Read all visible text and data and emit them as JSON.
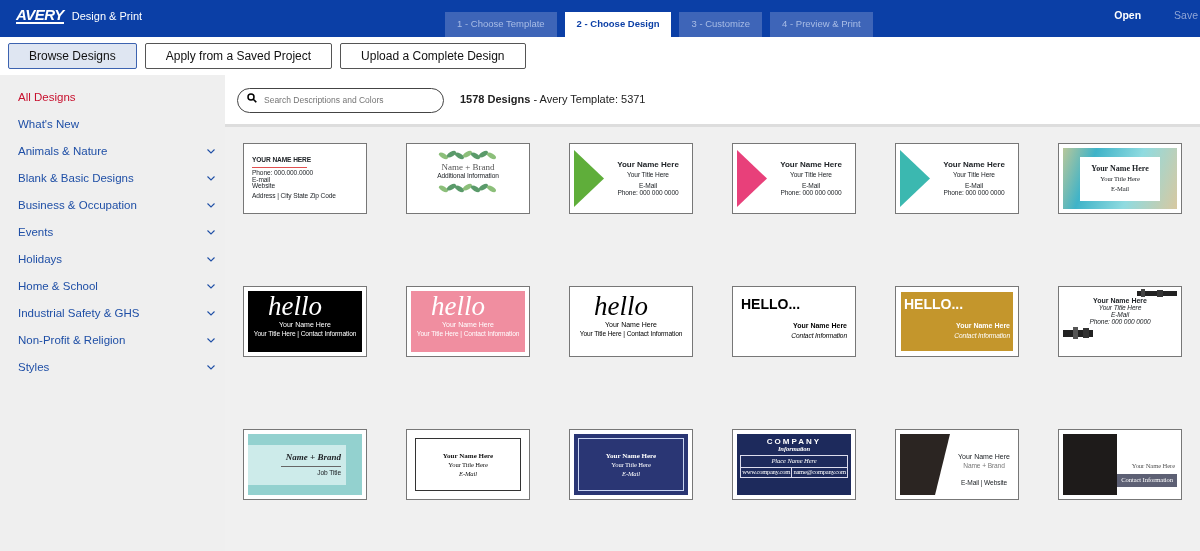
{
  "header": {
    "logo": "AVERY",
    "app_title": "Design & Print",
    "steps": [
      {
        "label": "1 - Choose Template",
        "selected": false
      },
      {
        "label": "2 - Choose Design",
        "selected": true
      },
      {
        "label": "3 - Customize",
        "selected": false
      },
      {
        "label": "4 - Preview & Print",
        "selected": false
      }
    ],
    "actions": [
      {
        "label": "Open",
        "disabled": false
      },
      {
        "label": "Save",
        "disabled": true
      }
    ]
  },
  "source_buttons": [
    {
      "label": "Browse Designs",
      "selected": true
    },
    {
      "label": "Apply from a Saved Project",
      "selected": false
    },
    {
      "label": "Upload a Complete Design",
      "selected": false
    }
  ],
  "sidebar": {
    "items": [
      {
        "label": "All Designs",
        "selected": true,
        "expandable": false
      },
      {
        "label": "What's New",
        "selected": false,
        "expandable": false
      },
      {
        "label": "Animals & Nature",
        "selected": false,
        "expandable": true
      },
      {
        "label": "Blank & Basic Designs",
        "selected": false,
        "expandable": true
      },
      {
        "label": "Business & Occupation",
        "selected": false,
        "expandable": true
      },
      {
        "label": "Events",
        "selected": false,
        "expandable": true
      },
      {
        "label": "Holidays",
        "selected": false,
        "expandable": true
      },
      {
        "label": "Home & School",
        "selected": false,
        "expandable": true
      },
      {
        "label": "Industrial Safety & GHS",
        "selected": false,
        "expandable": true
      },
      {
        "label": "Non-Profit & Religion",
        "selected": false,
        "expandable": true
      },
      {
        "label": "Styles",
        "selected": false,
        "expandable": true
      }
    ]
  },
  "search": {
    "placeholder": "Search Descriptions and Colors"
  },
  "result_summary": "**1578 Designs** - Avery Template: 5371",
  "designs": [
    {
      "kind": "basic",
      "lines": [
        "YOUR NAME HERE",
        "Phone: 000.000.0000",
        "E-mail",
        "Website",
        "Address | City State Zip Code"
      ]
    },
    {
      "kind": "leaf",
      "lines": [
        "Name + Brand",
        "Additional Information"
      ]
    },
    {
      "kind": "triangle",
      "color": "#5fae3a",
      "lines": [
        "Your Name Here",
        "Your Title Here",
        "E-Mail",
        "Phone: 000 000 0000"
      ]
    },
    {
      "kind": "triangle",
      "color": "#e8407a",
      "lines": [
        "Your Name Here",
        "Your Title Here",
        "E-Mail",
        "Phone: 000 000 0000"
      ]
    },
    {
      "kind": "triangle",
      "color": "#3bb8b0",
      "lines": [
        "Your Name Here",
        "Your Title Here",
        "E-Mail",
        "Phone: 000 000 0000"
      ]
    },
    {
      "kind": "watercolor",
      "lines": [
        "Your Name Here",
        "Your Title Here",
        "E-Mail"
      ]
    },
    {
      "kind": "hello",
      "color": "#000000",
      "lines": [
        "hello",
        "Your Name Here",
        "Your Title Here | Contact Information"
      ]
    },
    {
      "kind": "hello",
      "color": "#f08ea0",
      "lines": [
        "hello",
        "Your Name Here",
        "Your Title Here | Contact Information"
      ]
    },
    {
      "kind": "hello",
      "color": "#ffffff",
      "lines": [
        "hello",
        "Your Name Here",
        "Your Title Here | Contact Information"
      ]
    },
    {
      "kind": "shout",
      "color": "#ffffff",
      "lines": [
        "HELLO...",
        "Your Name Here",
        "Contact Information"
      ]
    },
    {
      "kind": "shout",
      "color": "#c4962c",
      "lines": [
        "HELLO...",
        "Your Name Here",
        "Contact Information"
      ]
    },
    {
      "kind": "grunge",
      "lines": [
        "Your Name Here",
        "Your Title Here",
        "E-Mail",
        "Phone: 000 000 0000"
      ]
    },
    {
      "kind": "mint",
      "lines": [
        "Name + Brand",
        "Job Title"
      ]
    },
    {
      "kind": "framed",
      "color": "#ffffff",
      "lines": [
        "Your Name Here",
        "Your Title Here",
        "E-Mail"
      ]
    },
    {
      "kind": "framed",
      "color": "#2a3674",
      "lines": [
        "Your Name Here",
        "Your Title Here",
        "E-Mail"
      ]
    },
    {
      "kind": "company",
      "lines": [
        "COMPANY",
        "Information",
        "Place Name Here",
        "www.company.com",
        "name@company.com"
      ]
    },
    {
      "kind": "photo-slant",
      "lines": [
        "Your Name Here",
        "Name + Brand",
        "E-Mail | Website"
      ]
    },
    {
      "kind": "photo-box",
      "lines": [
        "Your Name Here",
        "Contact Information"
      ]
    }
  ]
}
